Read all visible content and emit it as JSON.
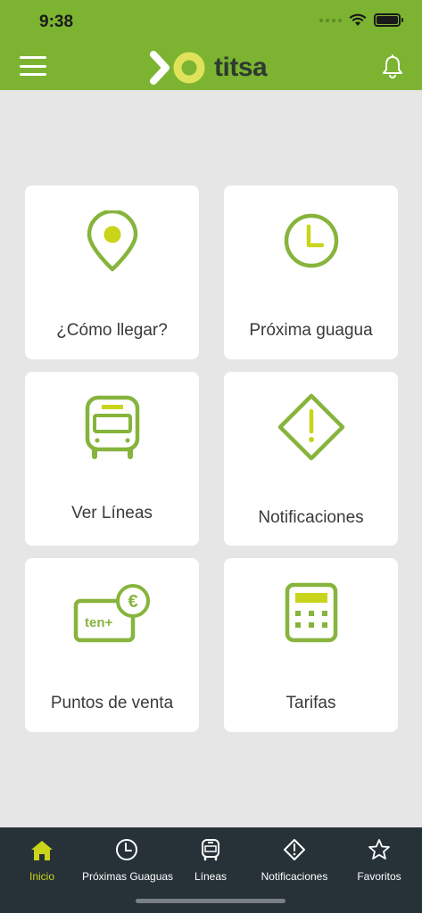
{
  "status": {
    "time": "9:38"
  },
  "header": {
    "logo_text": "titsa"
  },
  "tiles": [
    {
      "label": "¿Cómo llegar?",
      "icon": "location-pin-icon"
    },
    {
      "label": "Próxima guagua",
      "icon": "clock-icon"
    },
    {
      "label": "Ver Líneas",
      "icon": "bus-icon"
    },
    {
      "label": "Notificaciones",
      "icon": "warning-diamond-icon"
    },
    {
      "label": "Puntos de venta",
      "icon": "ten-card-icon",
      "card_text": "ten+",
      "currency": "€"
    },
    {
      "label": "Tarifas",
      "icon": "calculator-icon"
    }
  ],
  "tabbar": {
    "items": [
      {
        "label": "Inicio",
        "icon": "home-icon",
        "active": true
      },
      {
        "label": "Próximas Guaguas",
        "icon": "clock-icon",
        "active": false
      },
      {
        "label": "Líneas",
        "icon": "bus-icon",
        "active": false
      },
      {
        "label": "Notificaciones",
        "icon": "warning-diamond-icon",
        "active": false
      },
      {
        "label": "Favoritos",
        "icon": "star-icon",
        "active": false
      }
    ]
  },
  "colors": {
    "brand_green": "#7cb432",
    "icon_green": "#86b43c",
    "accent_yellow": "#c9d41a",
    "tabbar_bg": "#263238",
    "background": "#e6e6e6"
  }
}
